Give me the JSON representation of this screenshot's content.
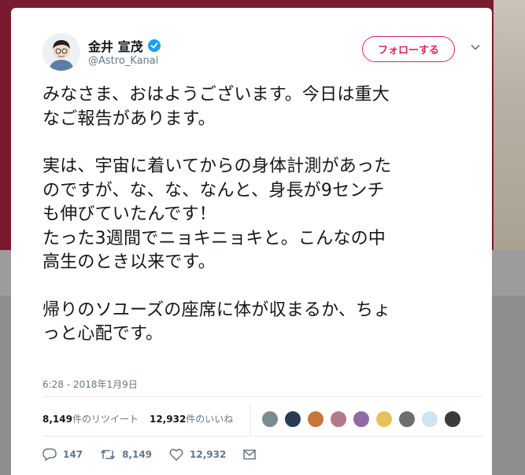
{
  "author": {
    "name": "金井 宣茂",
    "handle": "@Astro_Kanai",
    "verified": true
  },
  "follow_button": {
    "label": "フォローする"
  },
  "tweet": {
    "paragraphs": [
      [
        "みなさま、おはようございます。今日は重大",
        "なご報告があります。"
      ],
      [
        "実は、宇宙に着いてからの身体計測があった",
        "のですが、な、な、なんと、身長が9センチ",
        "も伸びていたんです！",
        "たった3週間でニョキニョキと。こんなの中",
        "高生のとき以来です。"
      ],
      [
        "帰りのソユーズの座席に体が収まるか、ちょ",
        "っと心配です。"
      ]
    ],
    "timestamp": "6:28 - 2018年1月9日"
  },
  "stats": {
    "retweets_count": "8,149",
    "retweets_label": "件のリツイート",
    "likes_count": "12,932",
    "likes_label": "件のいいね"
  },
  "likers": [
    {
      "color": "#7b8c8f"
    },
    {
      "color": "#2a3b55"
    },
    {
      "color": "#c8753a"
    },
    {
      "color": "#b07a8a"
    },
    {
      "color": "#8f6aa8"
    },
    {
      "color": "#e6c35a"
    },
    {
      "color": "#6d6d6d"
    },
    {
      "color": "#cfe3f0"
    },
    {
      "color": "#3b3b3b"
    }
  ],
  "actions": {
    "reply_count": "147",
    "retweet_count": "8,149",
    "like_count": "12,932"
  },
  "colors": {
    "accent": "#e0245e",
    "verified": "#1da1f2",
    "text": "#14171a",
    "muted": "#657786"
  },
  "icons": [
    "verified-badge-icon",
    "chevron-down-icon",
    "reply-icon",
    "retweet-icon",
    "like-icon",
    "direct-message-icon"
  ]
}
